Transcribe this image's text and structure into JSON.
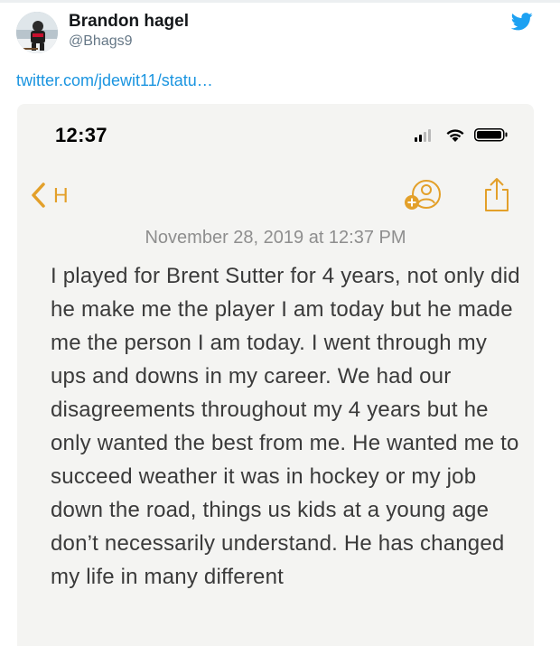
{
  "tweet": {
    "display_name": "Brandon hagel",
    "handle": "@Bhags9",
    "link_text": "twitter.com/jdewit11/statu…"
  },
  "phone": {
    "time": "12:37",
    "back_label": "H",
    "date": "November 28, 2019 at 12:37 PM",
    "note_text": "I played for Brent Sutter for 4 years, not only did he make me the player I am today but he made me the person I am today. I went through my ups and downs in my career. We had our disagreements throughout my 4 years but he only wanted the best from me. He wanted me to succeed weather it was in hockey or my job down the road, things us kids at a young age don’t necessarily understand. He has changed my life in many different"
  },
  "icons": {
    "twitter": "twitter-bird-icon",
    "back": "chevron-left-icon",
    "add_person": "add-person-icon",
    "share": "share-icon",
    "signal": "cellular-signal-icon",
    "wifi": "wifi-icon",
    "battery": "battery-icon"
  },
  "colors": {
    "twitter_blue": "#1da1f2",
    "link_blue": "#1b95e0",
    "notes_accent": "#e3a02a",
    "note_background": "#f4f4f2"
  }
}
